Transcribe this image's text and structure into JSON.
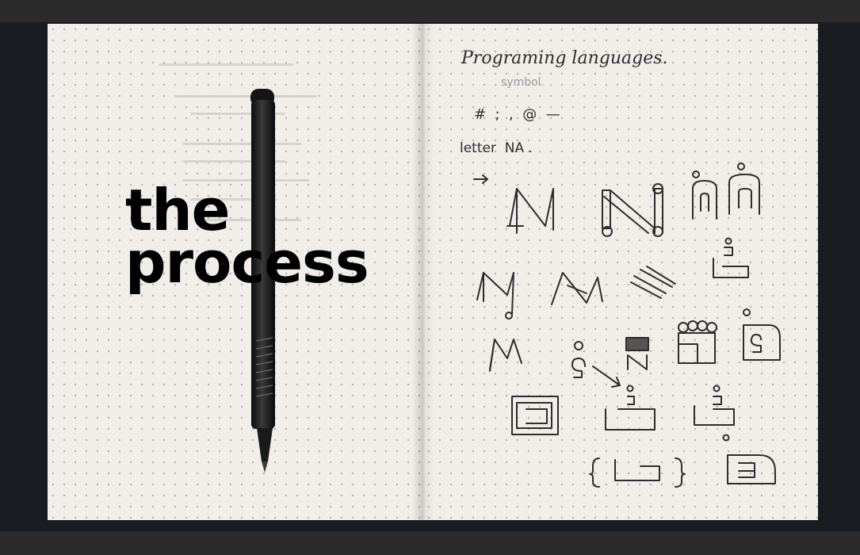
{
  "overlay": {
    "heading": "the\nprocess"
  },
  "notebook": {
    "right_page": {
      "heading": "Programing languages.",
      "subheading": "symbol.",
      "symbols_row": "#  ;  ,  @  —",
      "letter_label": "letter  NA ."
    },
    "left_page": {
      "writing": "faint show-through handwriting (illegible)"
    }
  },
  "props": {
    "pen": "black ballpoint pen"
  },
  "colors": {
    "background": "#191c20",
    "paper": "#f1eeea",
    "ink": "#2d2d2d",
    "heading": "#000000"
  }
}
